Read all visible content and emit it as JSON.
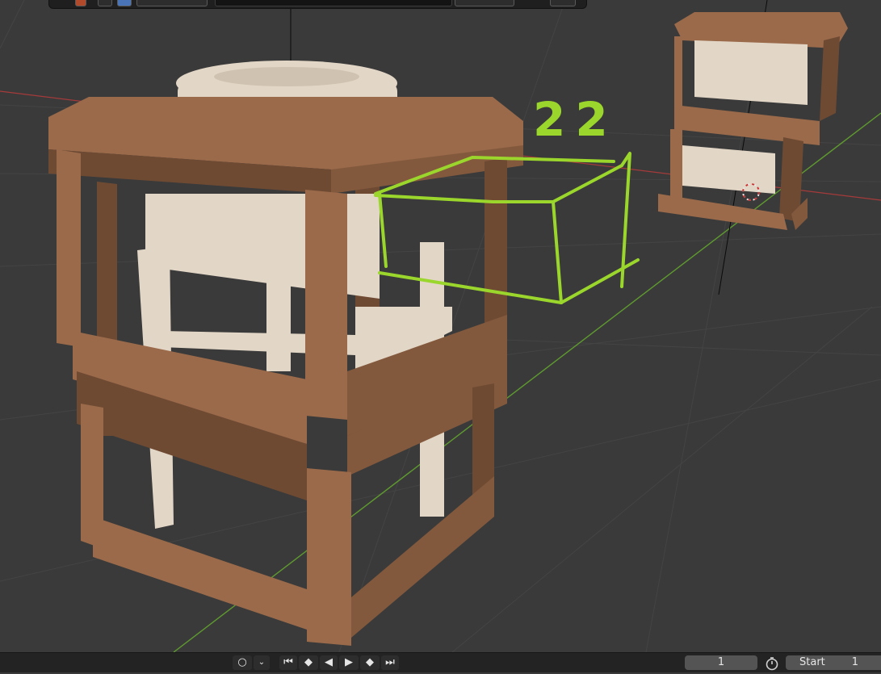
{
  "viewport": {
    "annotation_text": "22",
    "annotation_color": "#9bd62c",
    "background_color": "#3a3a3a",
    "wood_color": "#9a6a4a",
    "part_color": "#e2d6c6",
    "x_axis_color": "#a63a3a",
    "y_axis_color": "#5f9a2f"
  },
  "header": {
    "icons": [
      "object-type-icon",
      "viewport-shading-icon",
      "overlay-icon",
      "gizmo-icon"
    ]
  },
  "timeline": {
    "playback_icon": "playback-mode-icon",
    "current_frame": "1",
    "start_label": "Start",
    "start_value": "1"
  }
}
